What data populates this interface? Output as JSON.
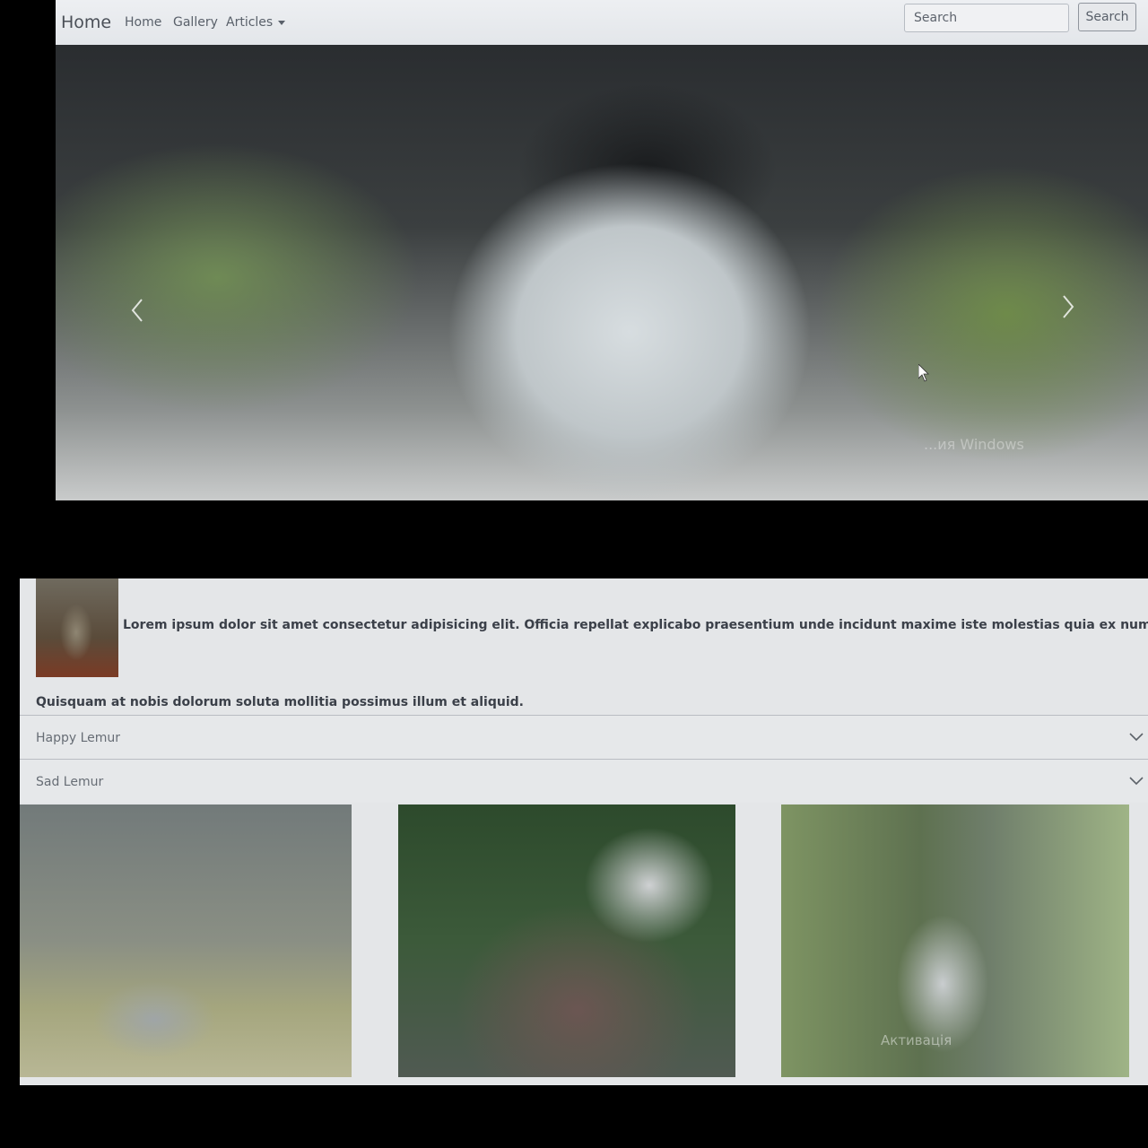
{
  "navbar": {
    "brand": "Home",
    "links": [
      "Home",
      "Gallery",
      "Articles"
    ],
    "search_placeholder": "Search",
    "search_button": "Search"
  },
  "carousel": {
    "watermark": "...ия Windows"
  },
  "article": {
    "lead": "Lorem ipsum dolor sit amet consectetur adipisicing elit. Officia repellat explicabo praesentium unde incidunt maxime iste molestias quia ex numquam.",
    "follow": "Quisquam at nobis dolorum soluta mollitia possimus illum et aliquid."
  },
  "accordion": [
    {
      "label": "Happy Lemur"
    },
    {
      "label": "Sad Lemur"
    }
  ],
  "gallery_watermark": "Активація"
}
